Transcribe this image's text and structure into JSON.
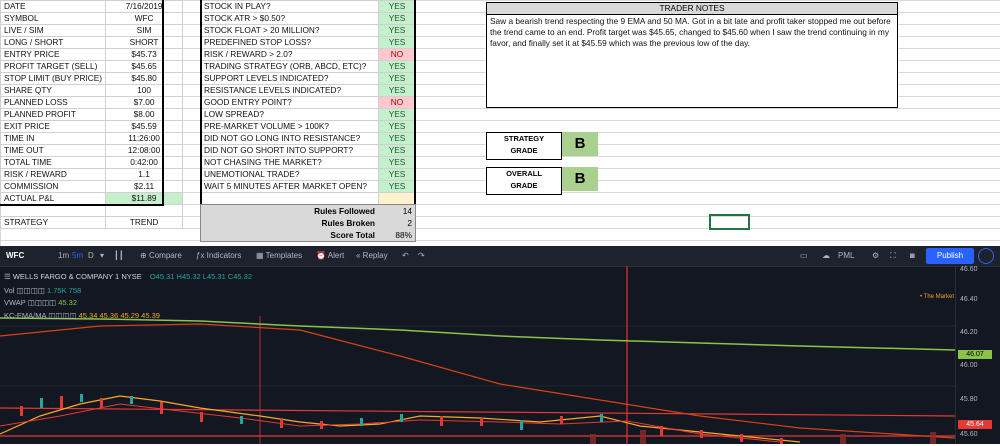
{
  "trade_table": [
    {
      "key": "DATE",
      "value": "7/16/2019"
    },
    {
      "key": "SYMBOL",
      "value": "WFC"
    },
    {
      "key": "LIVE / SIM",
      "value": "SIM"
    },
    {
      "key": "LONG / SHORT",
      "value": "SHORT"
    },
    {
      "key": "ENTRY PRICE",
      "value": "$45.73"
    },
    {
      "key": "PROFIT TARGET (SELL)",
      "value": "$45.65"
    },
    {
      "key": "STOP LIMIT (BUY PRICE)",
      "value": "$45.80"
    },
    {
      "key": "SHARE QTY",
      "value": "100"
    },
    {
      "key": "PLANNED LOSS",
      "value": "$7.00"
    },
    {
      "key": "PLANNED PROFIT",
      "value": "$8.00"
    },
    {
      "key": "EXIT PRICE",
      "value": "$45.59"
    },
    {
      "key": "TIME IN",
      "value": "11:26:00"
    },
    {
      "key": "TIME OUT",
      "value": "12:08:00"
    },
    {
      "key": "TOTAL TIME",
      "value": "0:42:00"
    },
    {
      "key": "RISK / REWARD",
      "value": "1.1"
    },
    {
      "key": "COMMISSION",
      "value": "$2.11"
    },
    {
      "key": "ACTUAL P&L",
      "value": "$11.89"
    },
    {
      "key": "",
      "value": ""
    },
    {
      "key": "STRATEGY",
      "value": "TREND"
    }
  ],
  "rules": [
    {
      "q": "STOCK IN PLAY?",
      "a": "YES"
    },
    {
      "q": "STOCK ATR > $0.50?",
      "a": "YES"
    },
    {
      "q": "STOCK FLOAT > 20 MILLION?",
      "a": "YES"
    },
    {
      "q": "PREDEFINED STOP LOSS?",
      "a": "YES"
    },
    {
      "q": "RISK / REWARD > 2.0?",
      "a": "NO"
    },
    {
      "q": "TRADING STRATEGY (ORB, ABCD, ETC)?",
      "a": "YES"
    },
    {
      "q": "SUPPORT LEVELS INDICATED?",
      "a": "YES"
    },
    {
      "q": "RESISTANCE LEVELS INDICATED?",
      "a": "YES"
    },
    {
      "q": "GOOD ENTRY POINT?",
      "a": "NO"
    },
    {
      "q": "LOW SPREAD?",
      "a": "YES"
    },
    {
      "q": "PRE-MARKET VOLUME > 100K?",
      "a": "YES"
    },
    {
      "q": "DID NOT GO LONG INTO RESISTANCE?",
      "a": "YES"
    },
    {
      "q": "DID NOT GO SHORT INTO SUPPORT?",
      "a": "YES"
    },
    {
      "q": "NOT CHASING THE MARKET?",
      "a": "YES"
    },
    {
      "q": "UNEMOTIONAL TRADE?",
      "a": "YES"
    },
    {
      "q": "WAIT 5 MINUTES AFTER MARKET OPEN?",
      "a": "YES"
    }
  ],
  "score": {
    "followed_label": "Rules Followed",
    "followed": "14",
    "broken_label": "Rules Broken",
    "broken": "2",
    "total_label": "Score Total",
    "total": "88%"
  },
  "notes": {
    "header": "TRADER NOTES",
    "text": "Saw a bearish trend respecting the 9 EMA and 50 MA. Got in a bit late and profit taker stopped me out before the trend came to an end. Profit target was $45.65, changed to $45.60 when I saw the trend continuing in my favor, and finally set it at $45.59 which was the previous low of the day."
  },
  "grades": {
    "strategy_label_1": "STRATEGY",
    "strategy_label_2": "GRADE",
    "strategy": "B",
    "overall_label_1": "OVERALL",
    "overall_label_2": "GRADE",
    "overall": "B"
  },
  "chart": {
    "symbol": "WFC",
    "intervals": [
      "1m",
      "5m",
      "D"
    ],
    "toolbar": [
      "Compare",
      "Indicators",
      "Templates",
      "Alert",
      "Replay"
    ],
    "publish": "Publish",
    "pml": "PML",
    "title": "WELLS FARGO & COMPANY  1  NYSE",
    "ohlc": "O45.31 H45.32 L45.31 C45.32",
    "vol_label": "Vol",
    "vol_values": "1.75K  758",
    "vwap_label": "VWAP",
    "vwap_value": "45.32",
    "kc_label": "KC-EMA/MA",
    "kc_values": "45.34   45.36   45.29   45.39",
    "the_market": "• The Market",
    "price_ticks": [
      "46.60",
      "46.40",
      "46.20",
      "46.00",
      "45.80",
      "45.60"
    ],
    "green_tag": "46.07",
    "red_tag": "45.64",
    "colors": {
      "bg": "#131722",
      "green": "#8bc34a",
      "red": "#e53935",
      "blue": "#2962ff"
    }
  }
}
